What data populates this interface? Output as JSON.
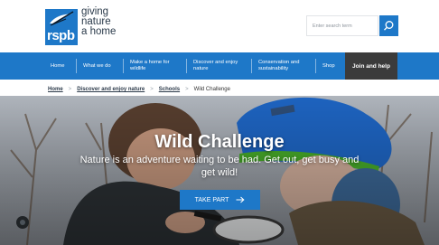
{
  "brand": {
    "logo_text": "rspb",
    "tagline": [
      "giving",
      "nature",
      "a home"
    ]
  },
  "search": {
    "placeholder": "Enter search term"
  },
  "nav": {
    "items": [
      {
        "label": "Home"
      },
      {
        "label": "What we do"
      },
      {
        "label": "Make a home for wildlife"
      },
      {
        "label": "Discover and enjoy nature"
      },
      {
        "label": "Conservation and sustainability"
      },
      {
        "label": "Shop"
      }
    ],
    "join_label": "Join and help"
  },
  "breadcrumb": {
    "items": [
      "Home",
      "Discover and enjoy nature",
      "Schools",
      "Wild Challenge"
    ]
  },
  "hero": {
    "title": "Wild Challenge",
    "subtitle": "Nature is an adventure waiting to be had. Get out, get busy and get wild!",
    "cta_label": "TAKE PART"
  },
  "colors": {
    "brand_blue": "#1e78c8",
    "join_dark": "#3b3b3b"
  },
  "icons": {
    "search": "magnifier-icon",
    "cta_arrow": "arrow-right-icon",
    "logo_bird": "avocet-bird-icon"
  }
}
